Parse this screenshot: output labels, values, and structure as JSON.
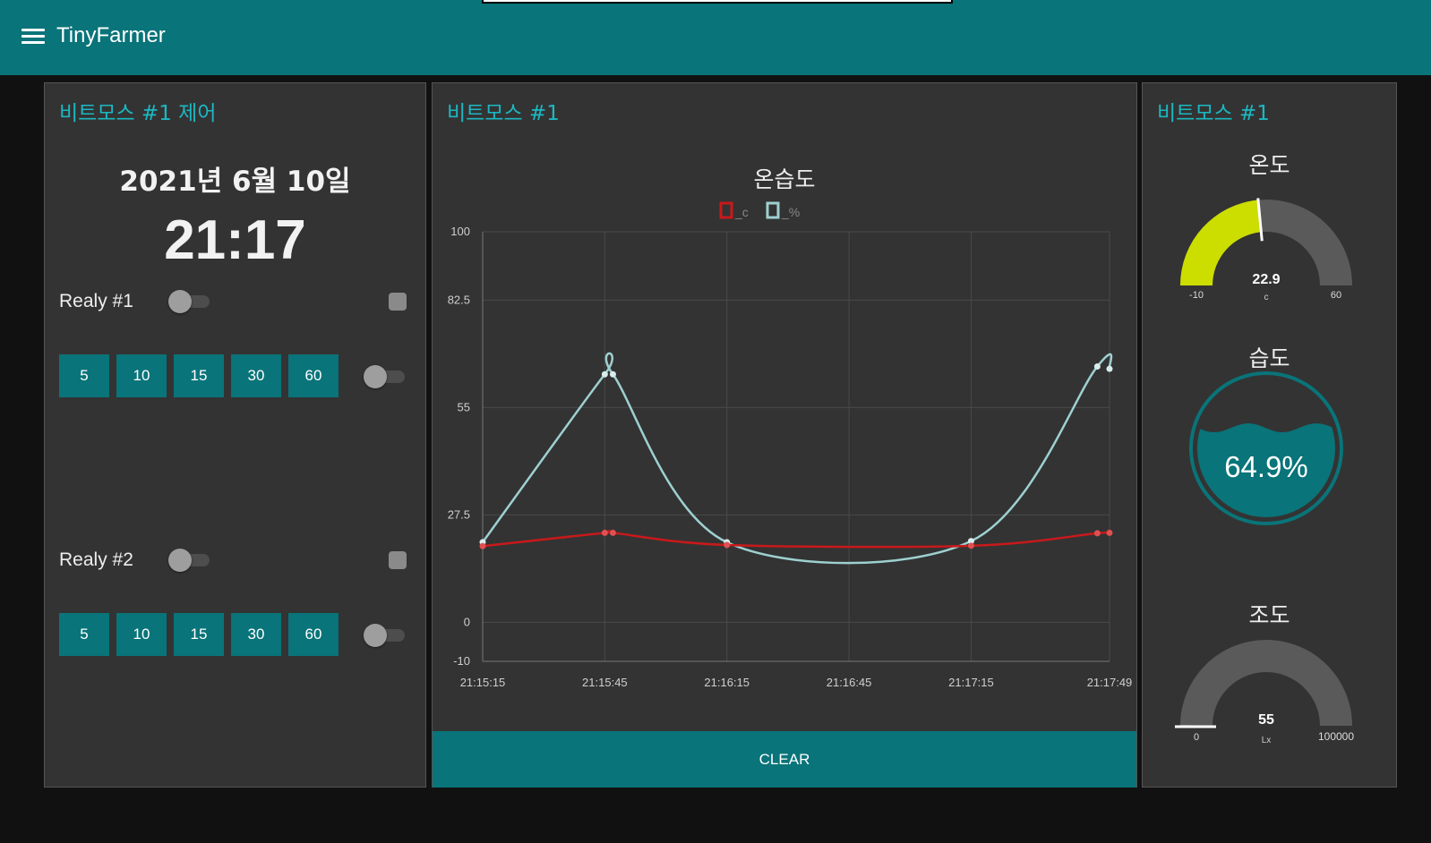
{
  "app": {
    "title": "TinyFarmer"
  },
  "control_panel": {
    "title": "비트모스 #1 제어",
    "date": "2021년 6월 10일",
    "time": "21:17",
    "relays": [
      {
        "label": "Realy #1",
        "timer_buttons": [
          "5",
          "10",
          "15",
          "30",
          "60"
        ],
        "switch_on": false,
        "timer_switch_on": false
      },
      {
        "label": "Realy #2",
        "timer_buttons": [
          "5",
          "10",
          "15",
          "30",
          "60"
        ],
        "switch_on": false,
        "timer_switch_on": false
      }
    ]
  },
  "chart_panel": {
    "title": "비트모스 #1",
    "clear_label": "CLEAR"
  },
  "chart_data": {
    "type": "line",
    "title": "온습도",
    "xlabel": "",
    "ylabel": "",
    "x": [
      "21:15:15",
      "21:15:45",
      "21:15:47",
      "21:16:15",
      "21:17:15",
      "21:17:46",
      "21:17:49"
    ],
    "x_ticks": [
      "21:15:15",
      "21:15:45",
      "21:16:15",
      "21:16:45",
      "21:17:15",
      "21:17:49"
    ],
    "y_ticks": [
      "100",
      "82.5",
      "55",
      "27.5",
      "0",
      "-10"
    ],
    "ylim": [
      -10,
      100
    ],
    "series": [
      {
        "name": "_c",
        "color": "#c9191b",
        "values": [
          19.5,
          22.9,
          22.9,
          19.8,
          19.6,
          22.8,
          22.9
        ]
      },
      {
        "name": "_%",
        "color": "#9ed0d0",
        "values": [
          20.5,
          63.5,
          63.5,
          20.5,
          20.8,
          65.5,
          64.9
        ]
      }
    ],
    "grid": true,
    "legend": "top"
  },
  "gauge_panel": {
    "title": "비트모스 #1",
    "temperature": {
      "title": "온도",
      "value": "22.9",
      "unit": "c",
      "min": "-10",
      "max": "60",
      "fraction": 0.47,
      "color": "#ccdd00"
    },
    "humidity": {
      "title": "습도",
      "value_text": "64.9%",
      "fraction": 0.649,
      "color": "#097479"
    },
    "illuminance": {
      "title": "조도",
      "value": "55",
      "unit": "Lx",
      "min": "0",
      "max": "100000",
      "fraction": 0.00055
    }
  }
}
